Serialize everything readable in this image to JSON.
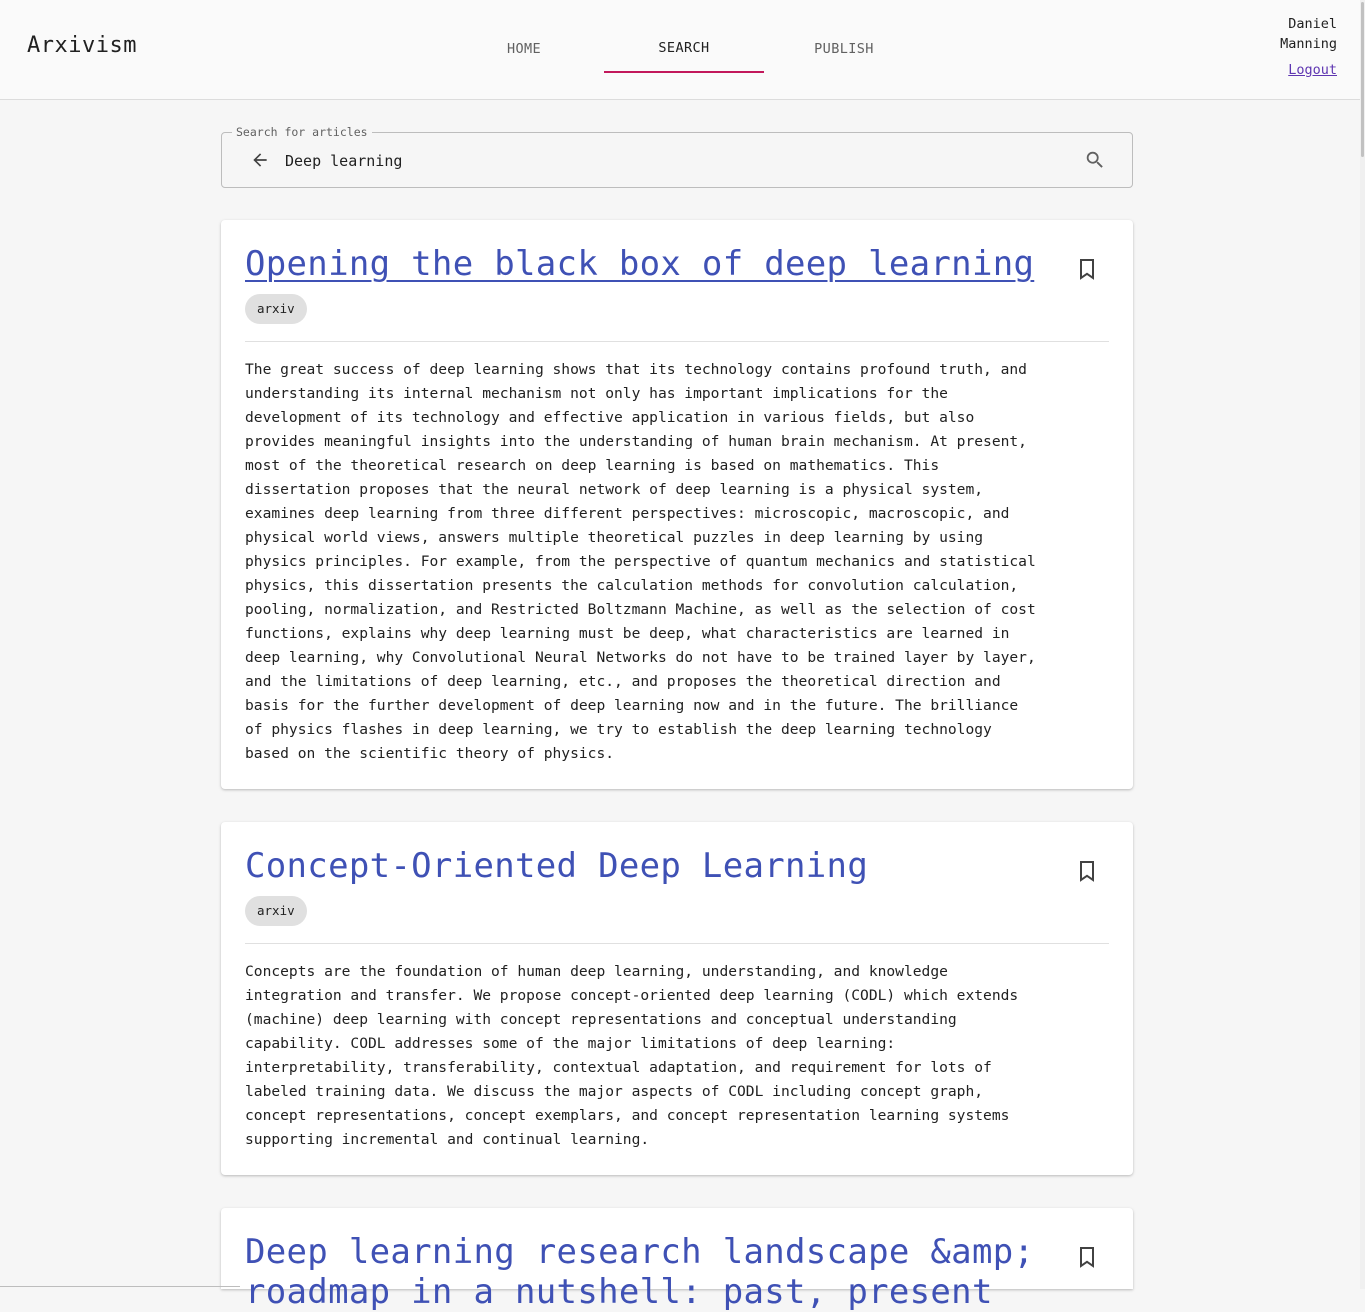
{
  "header": {
    "brand": "Arxivism",
    "tabs": [
      {
        "label": "HOME",
        "active": false
      },
      {
        "label": "SEARCH",
        "active": true
      },
      {
        "label": "PUBLISH",
        "active": false
      }
    ],
    "user": {
      "name": "Daniel Manning",
      "logout_label": "Logout"
    }
  },
  "search": {
    "legend": "Search for articles",
    "value": "Deep learning",
    "icons": {
      "back": "arrow-back-icon",
      "search": "search-icon"
    }
  },
  "results": [
    {
      "title": "Opening the black box of deep learning",
      "source": "arxiv",
      "abstract": "The great success of deep learning shows that its technology contains profound truth, and\nunderstanding its internal mechanism not only has important implications for the\ndevelopment of its technology and effective application in various fields, but also\nprovides meaningful insights into the understanding of human brain mechanism. At present,\nmost of the theoretical research on deep learning is based on mathematics. This\ndissertation proposes that the neural network of deep learning is a physical system,\nexamines deep learning from three different perspectives: microscopic, macroscopic, and\nphysical world views, answers multiple theoretical puzzles in deep learning by using\nphysics principles. For example, from the perspective of quantum mechanics and statistical\nphysics, this dissertation presents the calculation methods for convolution calculation,\npooling, normalization, and Restricted Boltzmann Machine, as well as the selection of cost\nfunctions, explains why deep learning must be deep, what characteristics are learned in\ndeep learning, why Convolutional Neural Networks do not have to be trained layer by layer,\nand the limitations of deep learning, etc., and proposes the theoretical direction and\nbasis for the further development of deep learning now and in the future. The brilliance\nof physics flashes in deep learning, we try to establish the deep learning technology\nbased on the scientific theory of physics."
    },
    {
      "title": "Concept-Oriented Deep Learning",
      "source": "arxiv",
      "abstract": "Concepts are the foundation of human deep learning, understanding, and knowledge\nintegration and transfer. We propose concept-oriented deep learning (CODL) which extends\n(machine) deep learning with concept representations and conceptual understanding\ncapability. CODL addresses some of the major limitations of deep learning:\ninterpretability, transferability, contextual adaptation, and requirement for lots of\nlabeled training data. We discuss the major aspects of CODL including concept graph,\nconcept representations, concept exemplars, and concept representation learning systems\nsupporting incremental and continual learning."
    },
    {
      "title": "Deep learning research landscape &amp; roadmap in a nutshell: past, present",
      "source": "",
      "abstract": ""
    }
  ],
  "icons": {
    "bookmark": "bookmark-icon"
  },
  "colors": {
    "title_link": "#3f51b5",
    "active_tab_underline": "#c2185b",
    "chip_bg": "#e0e0e0"
  }
}
